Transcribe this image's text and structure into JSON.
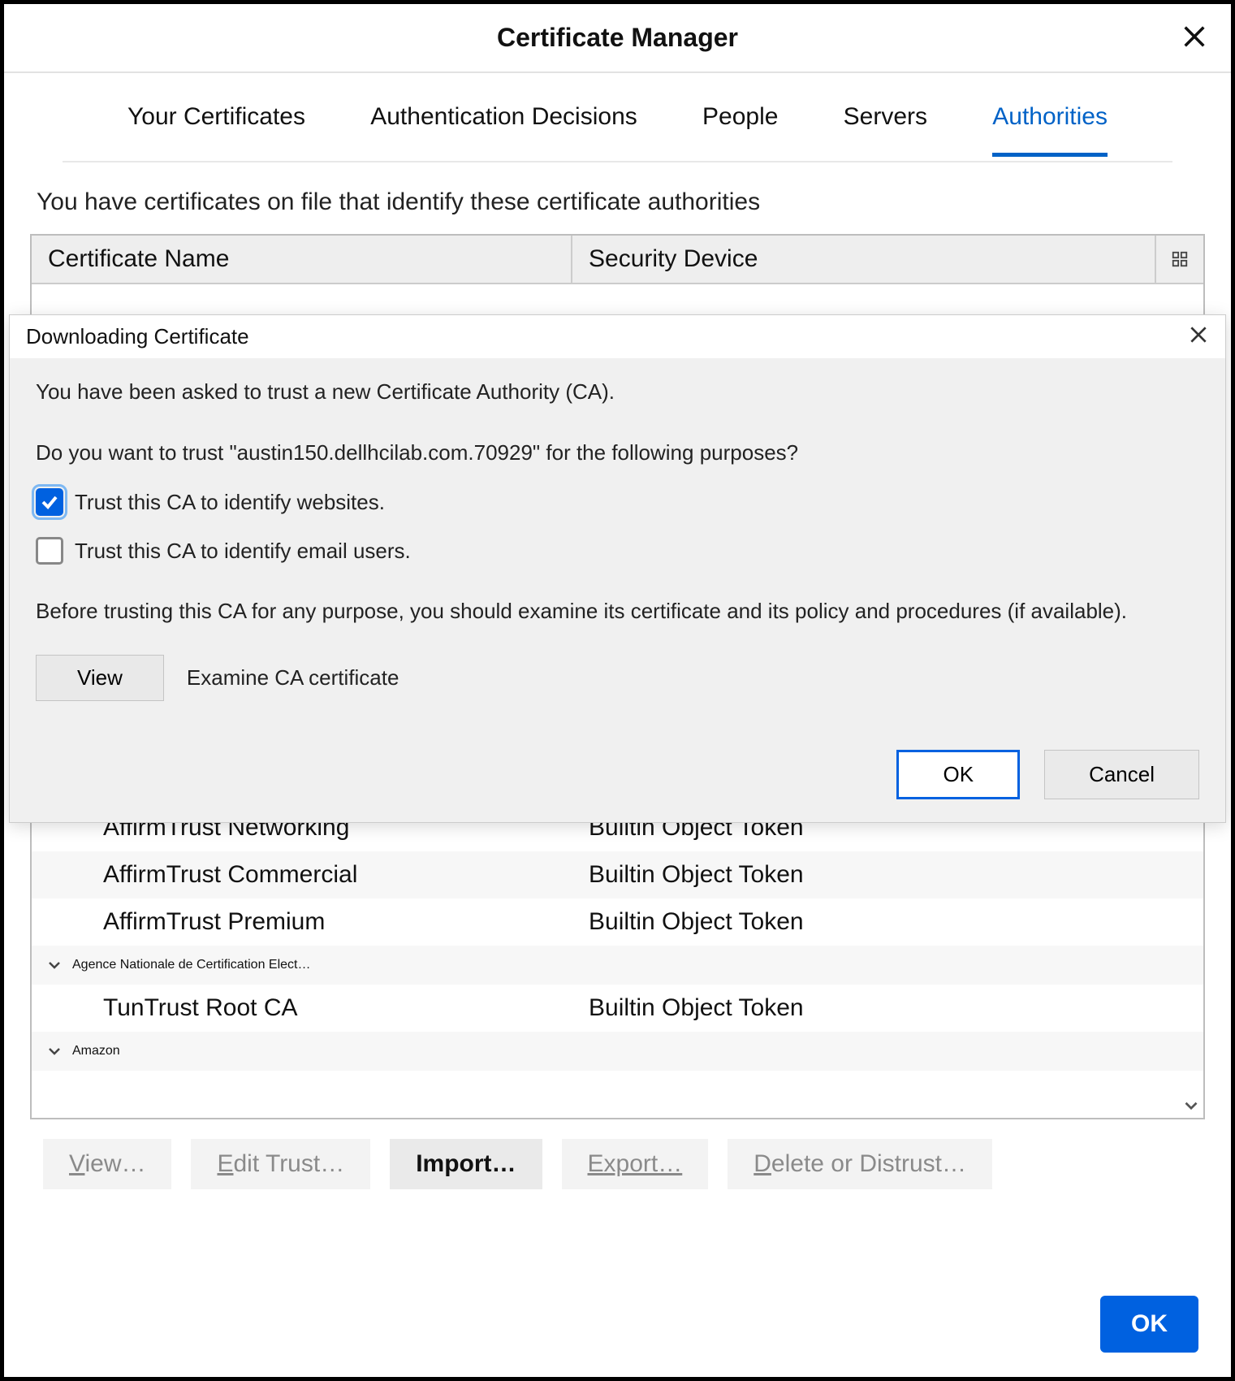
{
  "window": {
    "title": "Certificate Manager"
  },
  "tabs": {
    "your_certificates": "Your Certificates",
    "auth_decisions": "Authentication Decisions",
    "people": "People",
    "servers": "Servers",
    "authorities": "Authorities",
    "active": "authorities"
  },
  "intro": "You have certificates on file that identify these certificate authorities",
  "table": {
    "col_name": "Certificate Name",
    "col_device": "Security Device",
    "rows": [
      {
        "name": "AffirmTrust Networking",
        "device": "Builtin Object Token",
        "indent": true,
        "alt": false
      },
      {
        "name": "AffirmTrust Commercial",
        "device": "Builtin Object Token",
        "indent": true,
        "alt": true
      },
      {
        "name": "AffirmTrust Premium",
        "device": "Builtin Object Token",
        "indent": true,
        "alt": false
      }
    ],
    "group2": "Agence Nationale de Certification Elect…",
    "group2_child": {
      "name": "TunTrust Root CA",
      "device": "Builtin Object Token"
    },
    "group3": "Amazon"
  },
  "actions": {
    "view": "View…",
    "edit": "Edit Trust…",
    "import": "Import…",
    "export": "Export…",
    "delete": "Delete or Distrust…",
    "ok": "OK"
  },
  "modal": {
    "title": "Downloading Certificate",
    "p1": "You have been asked to trust a new Certificate Authority (CA).",
    "p2": "Do you want to trust \"austin150.dellhcilab.com.70929\" for the following purposes?",
    "cb1": {
      "label": "Trust this CA to identify websites.",
      "checked": true
    },
    "cb2": {
      "label": "Trust this CA to identify email users.",
      "checked": false
    },
    "p3": "Before trusting this CA for any purpose, you should examine its certificate and its policy and procedures (if available).",
    "view": "View",
    "examine": "Examine CA certificate",
    "ok": "OK",
    "cancel": "Cancel"
  }
}
